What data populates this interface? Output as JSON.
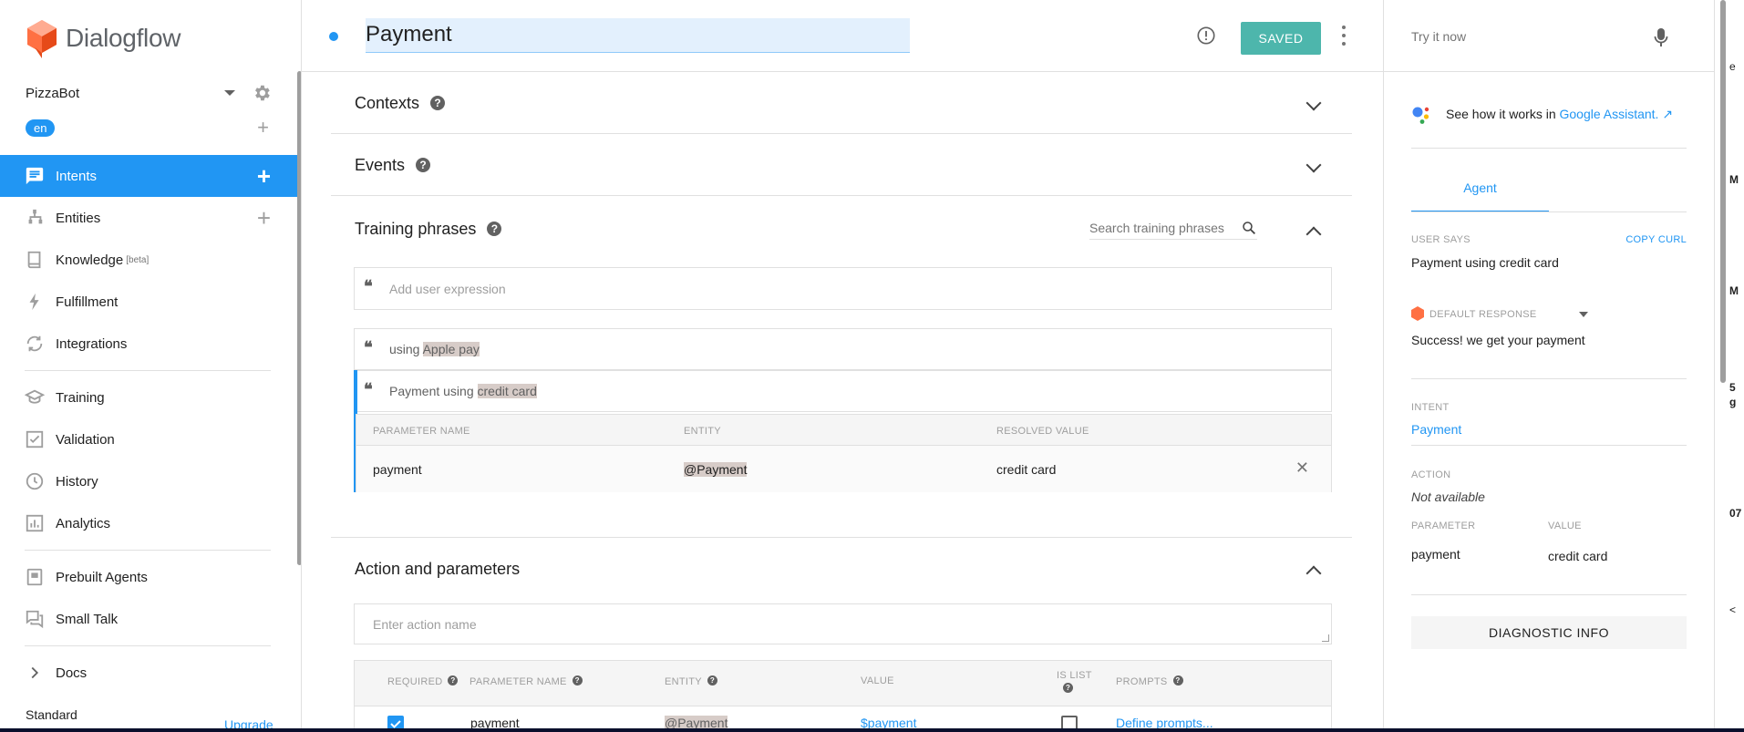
{
  "app": {
    "name": "Dialogflow"
  },
  "agent": {
    "name": "PizzaBot",
    "language": "en"
  },
  "sidebar": {
    "items": [
      {
        "label": "Intents",
        "icon": "chat-icon",
        "active": true,
        "add": true
      },
      {
        "label": "Entities",
        "icon": "hierarchy-icon",
        "add": true
      },
      {
        "label": "Knowledge",
        "badge": "[beta]",
        "icon": "book-icon"
      },
      {
        "label": "Fulfillment",
        "icon": "bolt-icon"
      },
      {
        "label": "Integrations",
        "icon": "sync-icon"
      },
      {
        "label": "Training",
        "icon": "graduation-cap-icon"
      },
      {
        "label": "Validation",
        "icon": "checkbox-icon"
      },
      {
        "label": "History",
        "icon": "clock-icon"
      },
      {
        "label": "Analytics",
        "icon": "bar-chart-icon"
      },
      {
        "label": "Prebuilt Agents",
        "icon": "agent-book-icon"
      },
      {
        "label": "Small Talk",
        "icon": "chat-bubbles-icon"
      },
      {
        "label": "Docs",
        "icon": "chevron-right-icon"
      }
    ],
    "plan": "Standard",
    "upgrade": "Upgrade"
  },
  "header": {
    "intent_name": "Payment",
    "save_label": "SAVED"
  },
  "sections": {
    "contexts": "Contexts",
    "events": "Events",
    "training_phrases": "Training phrases",
    "action_params": "Action and parameters"
  },
  "training": {
    "search_placeholder": "Search training phrases",
    "add_placeholder": "Add user expression",
    "phrases": [
      {
        "prefix": "using ",
        "entity": "Apple pay"
      },
      {
        "prefix": "Payment using ",
        "entity": "credit card"
      }
    ],
    "param_headers": {
      "name": "PARAMETER NAME",
      "entity": "ENTITY",
      "resolved": "RESOLVED VALUE"
    },
    "param_row": {
      "name": "payment",
      "entity": "@Payment",
      "resolved": "credit card"
    }
  },
  "action": {
    "placeholder": "Enter action name",
    "headers": {
      "required": "REQUIRED",
      "name": "PARAMETER NAME",
      "entity": "ENTITY",
      "value": "VALUE",
      "is_list": "IS LIST",
      "prompts": "PROMPTS"
    },
    "row": {
      "required": true,
      "name": "payment",
      "entity": "@Payment",
      "value": "$payment",
      "is_list": false,
      "prompts": "Define prompts..."
    }
  },
  "try_panel": {
    "placeholder": "Try it now",
    "ga_text": "See how it works in ",
    "ga_link": "Google Assistant.",
    "tab": "Agent",
    "user_says_label": "USER SAYS",
    "copy_curl": "COPY CURL",
    "user_says": "Payment using credit card",
    "default_response_label": "DEFAULT RESPONSE",
    "default_response": "Success! we get your payment",
    "intent_label": "INTENT",
    "intent": "Payment",
    "action_label": "ACTION",
    "action": "Not available",
    "parameter_label": "PARAMETER",
    "value_label": "VALUE",
    "parameter": "payment",
    "value": "credit card",
    "diagnostic": "DIAGNOSTIC INFO"
  },
  "edge_fragments": [
    "e",
    "M",
    "M",
    "5",
    "g",
    "07",
    "<"
  ],
  "colors": {
    "accent": "#2196f3",
    "saved": "#4db6ac",
    "entity_highlight": "#d7ccc8",
    "logo": "#ff7043"
  }
}
